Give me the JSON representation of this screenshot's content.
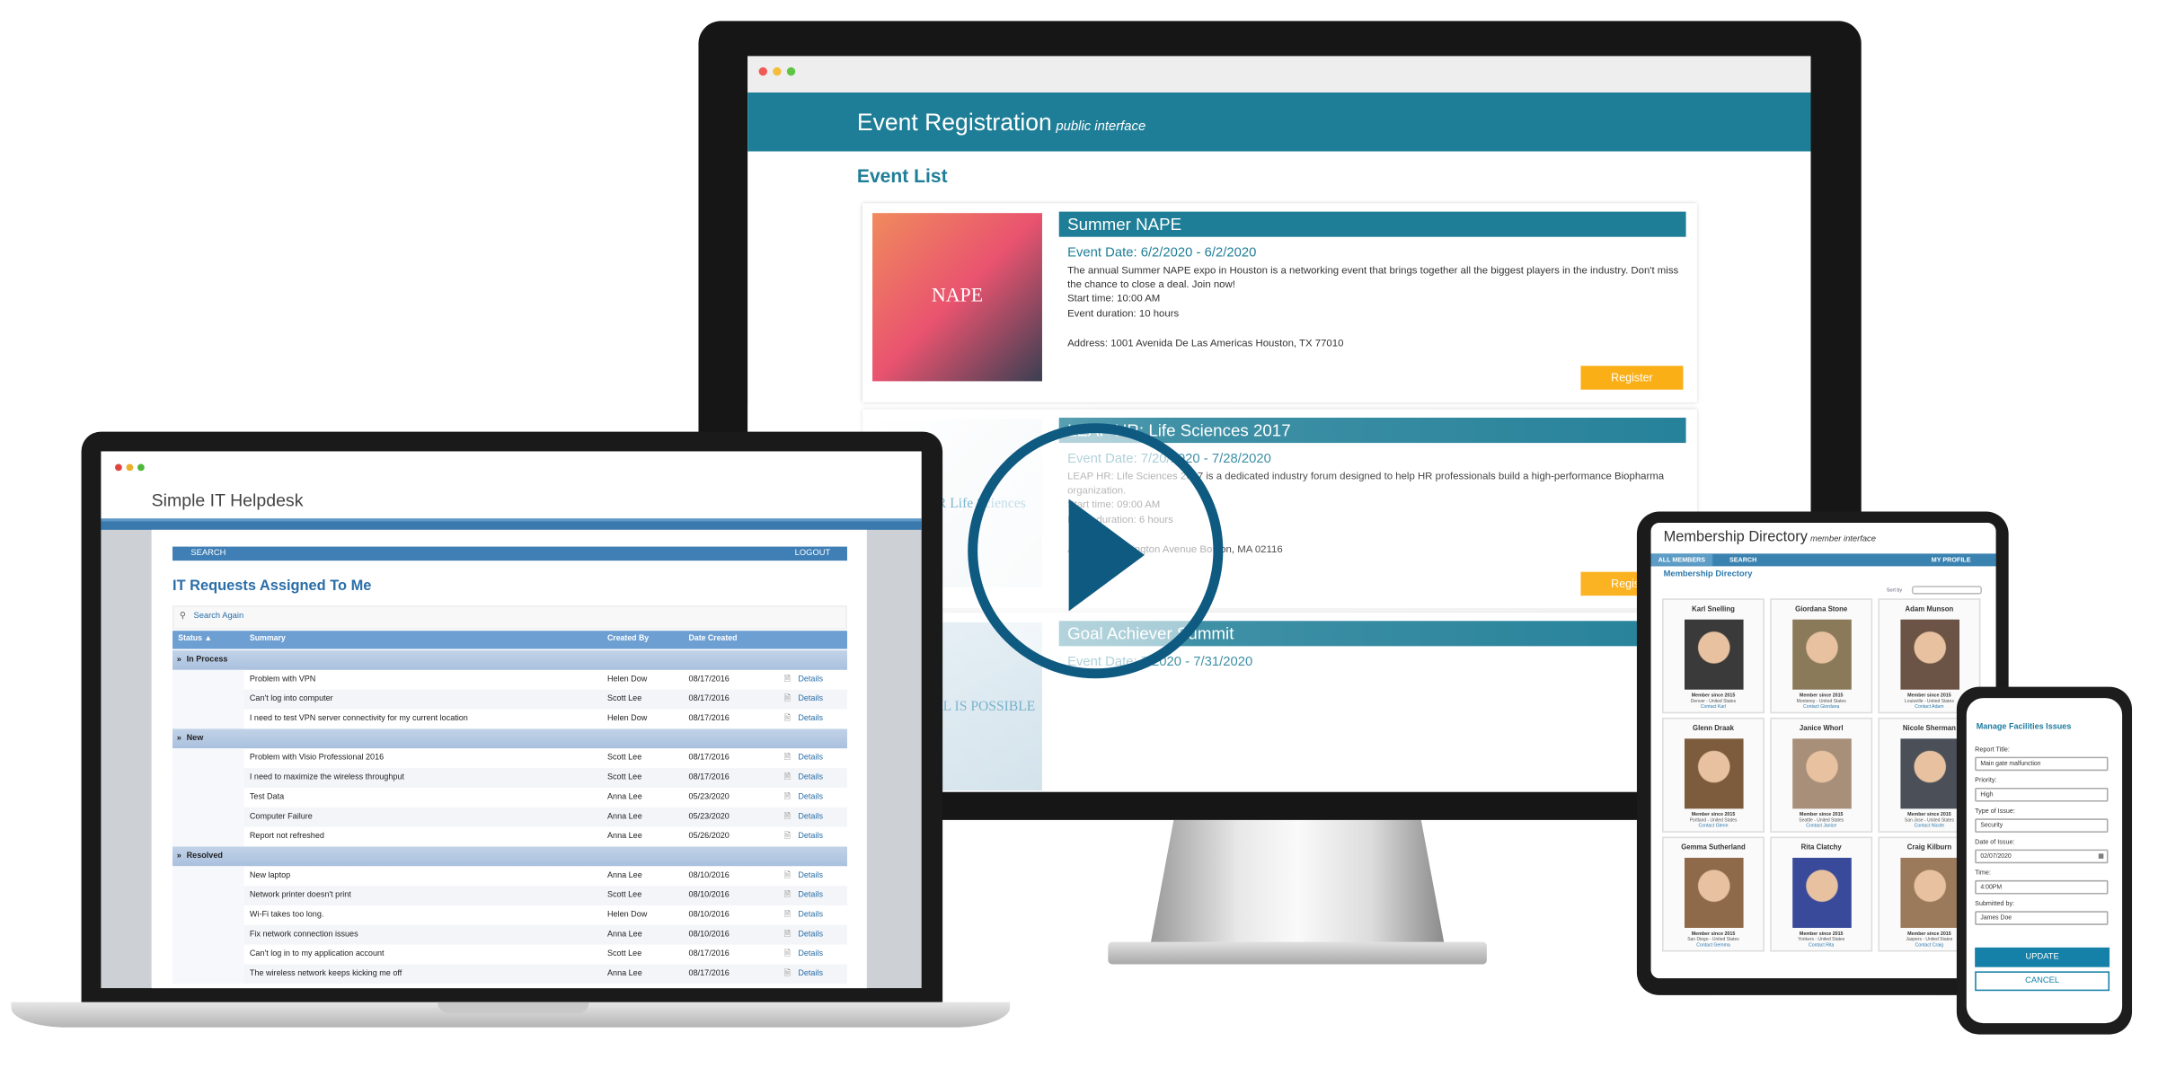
{
  "colors": {
    "teal": "#1f7e97",
    "register": "#fbaf17",
    "helpdesk_blue": "#3f7fb5",
    "play": "#0f5a81",
    "update": "#1580a8"
  },
  "event_app": {
    "title": "Event Registration",
    "subtitle": "public interface",
    "heading": "Event List",
    "events": [
      {
        "title": "Summer NAPE",
        "date": "Event Date: 6/2/2020 - 6/2/2020",
        "description": "The annual Summer NAPE expo in Houston is a networking event that brings together all the biggest players in the industry. Don't miss the chance to close a deal. Join now!",
        "start": "Start time: 10:00 AM",
        "duration": "Event duration: 10 hours",
        "address": "Address: 1001 Avenida De Las Americas Houston, TX 77010",
        "register": "Register",
        "image_text": "NAPE"
      },
      {
        "title": "LEAP HR: Life Sciences 2017",
        "date": "Event Date: 7/20/2020 - 7/28/2020",
        "description": "LEAP HR: Life Sciences 2017 is a dedicated industry forum designed to help HR professionals build a high-performance Biopharma organization.",
        "start": "Start time: 09:00 AM",
        "duration": "Event duration: 6 hours",
        "address": "Address: Huntington Avenue Boston, MA 02116",
        "register": "Register",
        "image_text": "LEAP HR Life Sciences"
      },
      {
        "title": "Goal Achiever Summit",
        "date": "Event Date: 7/2020 - 7/31/2020",
        "image_text": "ANY GOAL IS POSSIBLE"
      }
    ]
  },
  "helpdesk": {
    "title": "Simple IT Helpdesk",
    "nav_search": "SEARCH",
    "nav_logout": "LOGOUT",
    "heading": "IT Requests Assigned To Me",
    "search_again": "Search Again",
    "columns": [
      "Status ▲",
      "Summary",
      "Created By",
      "Date Created"
    ],
    "details_label": "Details",
    "groups": [
      {
        "name": "In Process",
        "rows": [
          [
            "Problem with VPN",
            "Helen Dow",
            "08/17/2016"
          ],
          [
            "Can't log into computer",
            "Scott Lee",
            "08/17/2016"
          ],
          [
            "I need to test VPN server connectivity for my current location",
            "Helen Dow",
            "08/17/2016"
          ]
        ]
      },
      {
        "name": "New",
        "rows": [
          [
            "Problem with Visio Professional 2016",
            "Scott Lee",
            "08/17/2016"
          ],
          [
            "I need to maximize the wireless throughput",
            "Scott Lee",
            "08/17/2016"
          ],
          [
            "Test Data",
            "Anna Lee",
            "05/23/2020"
          ],
          [
            "Computer Failure",
            "Anna Lee",
            "05/23/2020"
          ],
          [
            "Report not refreshed",
            "Anna Lee",
            "05/26/2020"
          ]
        ]
      },
      {
        "name": "Resolved",
        "rows": [
          [
            "New laptop",
            "Anna Lee",
            "08/10/2016"
          ],
          [
            "Network printer doesn't print",
            "Scott Lee",
            "08/10/2016"
          ],
          [
            "Wi-Fi takes too long.",
            "Helen Dow",
            "08/10/2016"
          ],
          [
            "Fix network connection issues",
            "Anna Lee",
            "08/10/2016"
          ],
          [
            "Can't log in to my application account",
            "Scott Lee",
            "08/17/2016"
          ],
          [
            "The wireless network keeps kicking me off",
            "Anna Lee",
            "08/17/2016"
          ]
        ]
      }
    ]
  },
  "directory": {
    "title": "Membership Directory",
    "subtitle": "member interface",
    "nav": [
      "ALL MEMBERS",
      "SEARCH",
      "MY PROFILE"
    ],
    "heading": "Membership Directory",
    "sort_label": "Sort by",
    "members": [
      {
        "name": "Karl Snelling",
        "since": "Member since 2015",
        "location": "Denver - United States",
        "contact": "Contact Karl"
      },
      {
        "name": "Giordana Stone",
        "since": "Member since 2015",
        "location": "Monterey - United States",
        "contact": "Contact Giordana"
      },
      {
        "name": "Adam Munson",
        "since": "Member since 2015",
        "location": "Louisville - United States",
        "contact": "Contact Adam"
      },
      {
        "name": "Glenn Draak",
        "since": "Member since 2015",
        "location": "Portland - United States",
        "contact": "Contact Glenn"
      },
      {
        "name": "Janice Whorl",
        "since": "Member since 2015",
        "location": "Seattle - United States",
        "contact": "Contact Janice"
      },
      {
        "name": "Nicole Sherman",
        "since": "Member since 2015",
        "location": "San Jose - United States",
        "contact": "Contact Nicole"
      },
      {
        "name": "Gemma Sutherland",
        "since": "Member since 2015",
        "location": "San Diego - United States",
        "contact": "Contact Gemma"
      },
      {
        "name": "Rita Clatchy",
        "since": "Member since 2015",
        "location": "Yonkers - United States",
        "contact": "Contact Rita"
      },
      {
        "name": "Craig Kilburn",
        "since": "Member since 2015",
        "location": "Jaspers - United States",
        "contact": "Contact Craig"
      }
    ]
  },
  "facilities": {
    "heading": "Manage Facilities Issues",
    "fields": [
      {
        "label": "Report Title:",
        "value": "Main gate malfunction"
      },
      {
        "label": "Priority:",
        "value": "High"
      },
      {
        "label": "Type of Issue:",
        "value": "Security"
      },
      {
        "label": "Date of Issue:",
        "value": "02/07/2020"
      },
      {
        "label": "Time:",
        "value": "4:00PM"
      },
      {
        "label": "Submitted by:",
        "value": "James Doe"
      }
    ],
    "update": "UPDATE",
    "cancel": "CANCEL"
  }
}
